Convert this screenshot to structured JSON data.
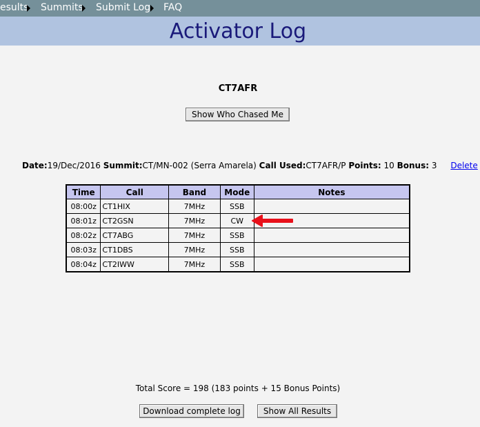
{
  "nav": {
    "items": [
      {
        "label": "esults"
      },
      {
        "label": "Summits"
      },
      {
        "label": "Submit Log"
      },
      {
        "label": "FAQ"
      }
    ]
  },
  "page": {
    "title": "Activator Log",
    "callsign": "CT7AFR",
    "show_chasers_label": "Show Who Chased Me"
  },
  "summary": {
    "date_label": "Date:",
    "date": "19/Dec/2016",
    "summit_label": "Summit:",
    "summit": "CT/MN-002 (Serra Amarela)",
    "call_used_label": "Call Used:",
    "call_used": "CT7AFR/P",
    "points_label": "Points:",
    "points": "10",
    "bonus_label": "Bonus:",
    "bonus": "3",
    "delete_label": "Delete"
  },
  "log_table": {
    "headers": [
      "Time",
      "Call",
      "Band",
      "Mode",
      "Notes"
    ],
    "rows": [
      {
        "time": "08:00z",
        "call": "CT1HIX",
        "band": "7MHz",
        "mode": "SSB",
        "notes": ""
      },
      {
        "time": "08:01z",
        "call": "CT2GSN",
        "band": "7MHz",
        "mode": "CW",
        "notes": ""
      },
      {
        "time": "08:02z",
        "call": "CT7ABG",
        "band": "7MHz",
        "mode": "SSB",
        "notes": ""
      },
      {
        "time": "08:03z",
        "call": "CT1DBS",
        "band": "7MHz",
        "mode": "SSB",
        "notes": ""
      },
      {
        "time": "08:04z",
        "call": "CT2IWW",
        "band": "7MHz",
        "mode": "SSB",
        "notes": ""
      }
    ]
  },
  "footer": {
    "total_score": "Total Score = 198 (183 points + 15 Bonus Points)",
    "download_label": "Download complete log",
    "show_all_label": "Show All Results"
  },
  "colors": {
    "nav_bg": "#75909a",
    "title_band": "#b0c3e0",
    "title_text": "#1a1a7a",
    "table_header": "#c6c6ef",
    "annotation_arrow": "#e8101a",
    "link": "#0000ee"
  }
}
